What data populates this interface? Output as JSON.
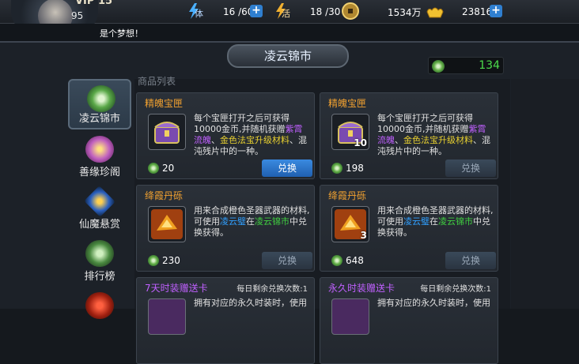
{
  "topbar": {
    "vip": "VIP 15",
    "level": "95",
    "stamina_label": "体",
    "stamina": "16 /60",
    "vigor_label": "活",
    "vigor": "18 /30",
    "coins": "1534万",
    "gold": "23816"
  },
  "message": "是个梦想！",
  "title": "凌云锦市",
  "jade_balance": "134",
  "list_header": "商品列表",
  "sidebar": [
    {
      "label": "凌云锦市",
      "active": true
    },
    {
      "label": "善缘珍阁",
      "active": false
    },
    {
      "label": "仙魔悬赏",
      "active": false
    },
    {
      "label": "排行榜",
      "active": false
    }
  ],
  "items": [
    {
      "name": "精魄宝匣",
      "desc_parts": [
        [
          "每个宝匣打开之后可获得10000金币,并随机获赠",
          ""
        ],
        [
          "紫霄流魄",
          "purple"
        ],
        [
          "、",
          ""
        ],
        [
          "金色法宝升级材料",
          "yellow"
        ],
        [
          "、混沌残片中的一种。",
          ""
        ]
      ],
      "price": "20",
      "button": "兑换",
      "button_enabled": true,
      "count": ""
    },
    {
      "name": "精魄宝匣",
      "desc_parts": [
        [
          "每个宝匣打开之后可获得10000金币,并随机获赠",
          ""
        ],
        [
          "紫霄流魄",
          "purple"
        ],
        [
          "、",
          ""
        ],
        [
          "金色法宝升级材料",
          "yellow"
        ],
        [
          "、混沌残片中的一种。",
          ""
        ]
      ],
      "price": "198",
      "button": "兑换",
      "button_enabled": false,
      "count": "10"
    },
    {
      "name": "绛霞丹砾",
      "desc_parts": [
        [
          "用来合成橙色圣器武器的材料,可使用",
          ""
        ],
        [
          "凌云璧",
          "blue"
        ],
        [
          "在",
          ""
        ],
        [
          "凌云锦市",
          "green"
        ],
        [
          "中兑换获得。",
          ""
        ]
      ],
      "price": "230",
      "button": "兑换",
      "button_enabled": false,
      "count": ""
    },
    {
      "name": "绛霞丹砾",
      "desc_parts": [
        [
          "用来合成橙色圣器武器的材料,可使用",
          ""
        ],
        [
          "凌云璧",
          "blue"
        ],
        [
          "在",
          ""
        ],
        [
          "凌云锦市",
          "green"
        ],
        [
          "中兑换获得。",
          ""
        ]
      ],
      "price": "648",
      "button": "兑换",
      "button_enabled": false,
      "count": "3"
    },
    {
      "name": "7天时装赠送卡",
      "limit": "每日剩余兑换次数:1",
      "desc_parts": [
        [
          "拥有对应的永久时装时，使用",
          ""
        ]
      ],
      "price": "",
      "button": "",
      "count": ""
    },
    {
      "name": "永久时装赠送卡",
      "limit": "每日剩余兑换次数:1",
      "desc_parts": [
        [
          "拥有对应的永久时装时，使用",
          ""
        ]
      ],
      "price": "",
      "button": "",
      "count": ""
    }
  ],
  "colors": {
    "purple": "#c060ff",
    "yellow": "#e8d030",
    "blue": "#30a0ff",
    "green": "#40d040",
    "orange_name": "#f0a030",
    "jade_green": "#4cdc4c"
  }
}
